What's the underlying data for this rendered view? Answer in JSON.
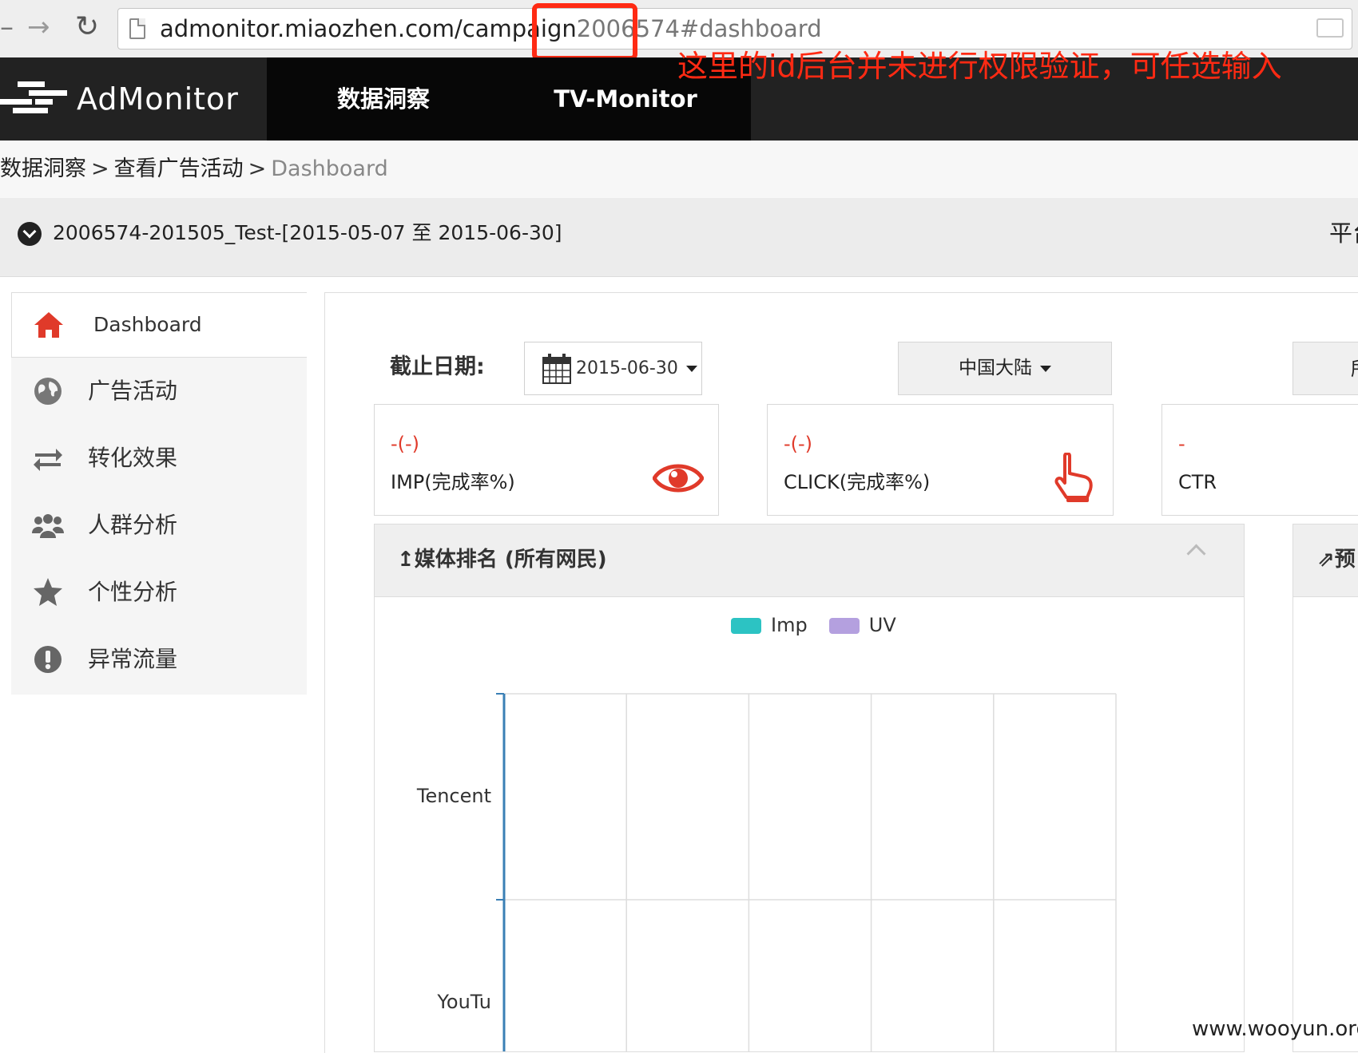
{
  "browser": {
    "url_host": "admonitor.miaozhen.com/campaign",
    "url_id": "2006574",
    "url_hash": "#dashboard"
  },
  "header": {
    "logo_text": "AdMonitor",
    "nav": [
      "数据洞察",
      "TV-Monitor"
    ]
  },
  "annotation": "这里的id后台并未进行权限验证，可任选输入",
  "breadcrumb": [
    "数据洞察",
    "查看广告活动",
    "Dashboard"
  ],
  "breadcrumb_sep": ">",
  "campaign": {
    "title": "2006574-201505_Test-[2015-05-07 至 2015-06-30]",
    "right_label": "平台"
  },
  "sidebar": {
    "items": [
      {
        "label": "Dashboard",
        "icon": "home-icon"
      },
      {
        "label": "广告活动",
        "icon": "globe-icon"
      },
      {
        "label": "转化效果",
        "icon": "exchange-icon"
      },
      {
        "label": "人群分析",
        "icon": "users-icon"
      },
      {
        "label": "个性分析",
        "icon": "star-icon"
      },
      {
        "label": "异常流量",
        "icon": "exclamation-icon"
      }
    ]
  },
  "filters": {
    "date_label": "截止日期:",
    "date_value": "2015-06-30",
    "region_value": "中国大陆",
    "third_value": "所"
  },
  "stats": [
    {
      "value": "-(-)",
      "label": "IMP(完成率%)",
      "icon": "eye-icon"
    },
    {
      "value": "-(-)",
      "label": "CLICK(完成率%)",
      "icon": "hand-pointer-icon"
    },
    {
      "value": "-",
      "label": "CTR"
    }
  ],
  "chart_panel": {
    "title": "媒体排名 (所有网民)",
    "side_title": "预"
  },
  "chart_data": {
    "type": "bar",
    "orientation": "horizontal",
    "categories": [
      "Tencent",
      "YouTu"
    ],
    "series": [
      {
        "name": "Imp",
        "color": "#2cc3c3",
        "values": [
          0,
          0
        ]
      },
      {
        "name": "UV",
        "color": "#b4a0df",
        "values": [
          0,
          0
        ]
      }
    ],
    "grid": true,
    "legend_position": "top"
  },
  "colors": {
    "header_bg": "#222222",
    "accent_red": "#e03a2a",
    "annotation_red": "#ff2a13",
    "axis_blue": "#3a7fb5"
  },
  "watermark": "www.wooyun.org"
}
